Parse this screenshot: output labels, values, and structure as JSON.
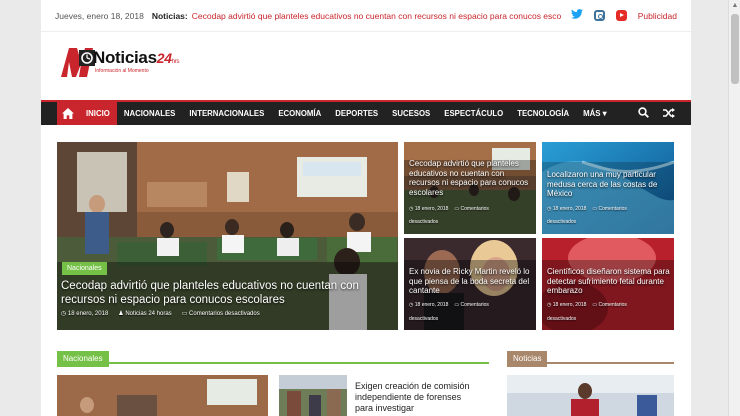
{
  "topbar": {
    "date": "Jueves, enero 18, 2018",
    "news_label": "Noticias:",
    "ticker": "Cecodap advirtió que planteles educativos no cuentan con recursos ni espacio para conucos escolares",
    "publicidad": "Publicidad",
    "icons": [
      "twitter-icon",
      "instagram-icon",
      "youtube-icon"
    ]
  },
  "logo": {
    "name": "Noticias",
    "number": "24",
    "suffix": "hrs",
    "tagline": "Información al Momento"
  },
  "nav": {
    "items": [
      "INICIO",
      "NACIONALES",
      "INTERNACIONALES",
      "ECONOMÍA",
      "DEPORTES",
      "SUCESOS",
      "ESPECTÁCULO",
      "TECNOLOGÍA",
      "MÁS ▾"
    ],
    "active": "INICIO",
    "icons": [
      "home-icon",
      "search-icon",
      "shuffle-icon"
    ]
  },
  "hero": {
    "category": "Nacionales",
    "title": "Cecodap advirtió que planteles educativos no cuentan con recursos ni espacio para conucos escolares",
    "date": "18 enero, 2018",
    "author": "Noticias 24 horas",
    "comments": "Comentarios desactivados"
  },
  "cards": [
    {
      "title": "Cecodap advirtió que planteles educativos no cuentan con recursos ni espacio para conucos escolares",
      "date": "18 enero, 2018",
      "comments": "Comentarios",
      "author": "desactivados"
    },
    {
      "title": "Localizaron una muy particular medusa cerca de las costas de México",
      "date": "18 enero, 2018",
      "comments": "Comentarios",
      "author": "desactivados"
    },
    {
      "title": "Ex novia de Ricky Martin reveló lo que piensa de la boda secreta del cantante",
      "date": "18 enero, 2018",
      "comments": "Comentarios",
      "author": "desactivados"
    },
    {
      "title": "Científicos diseñaron sistema para detectar sufrimiento fetal durante embarazo",
      "date": "18 enero, 2018",
      "comments": "Comentarios",
      "author": "desactivados"
    }
  ],
  "sections": {
    "left": "Nacionales",
    "right": "Noticias"
  },
  "bottom": {
    "title": "Exigen creación de comisión independiente de forenses para investigar"
  },
  "colors": {
    "brand_red": "#c9252c",
    "nav_bg": "#222222",
    "nacionales_green": "#75c046",
    "noticias_tan": "#a9876b"
  }
}
